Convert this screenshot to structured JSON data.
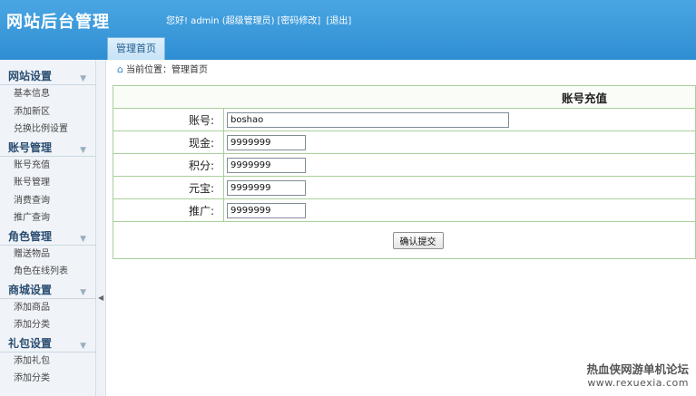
{
  "header": {
    "title": "网站后台管理",
    "greeting": "您好! admin (超级管理员)",
    "change_password": "[密码修改]",
    "logout": "[退出]",
    "tab_home": "管理首页"
  },
  "breadcrumb": {
    "text": "当前位置：管理首页"
  },
  "sidebar": {
    "groups": [
      {
        "title": "网站设置",
        "items": [
          "基本信息",
          "添加新区",
          "兑换比例设置"
        ]
      },
      {
        "title": "账号管理",
        "items": [
          "账号充值",
          "账号管理",
          "消费查询",
          "推广查询"
        ]
      },
      {
        "title": "角色管理",
        "items": [
          "赠送物品",
          "角色在线列表"
        ]
      },
      {
        "title": "商城设置",
        "items": [
          "添加商品",
          "添加分类"
        ]
      },
      {
        "title": "礼包设置",
        "items": [
          "添加礼包",
          "添加分类"
        ]
      }
    ]
  },
  "form": {
    "title": "账号充值",
    "fields": [
      {
        "label": "账号:",
        "value": "boshao"
      },
      {
        "label": "现金:",
        "value": "9999999"
      },
      {
        "label": "积分:",
        "value": "9999999"
      },
      {
        "label": "元宝:",
        "value": "9999999"
      },
      {
        "label": "推广:",
        "value": "9999999"
      }
    ],
    "submit_label": "确认提交"
  },
  "watermark": {
    "text": "热血侠网游单机论坛",
    "url": "www.rexuexia.com"
  },
  "colors": {
    "header": "#3797da",
    "table_border": "#a9cf9a",
    "sidebar_bg": "#f0f4f8"
  }
}
